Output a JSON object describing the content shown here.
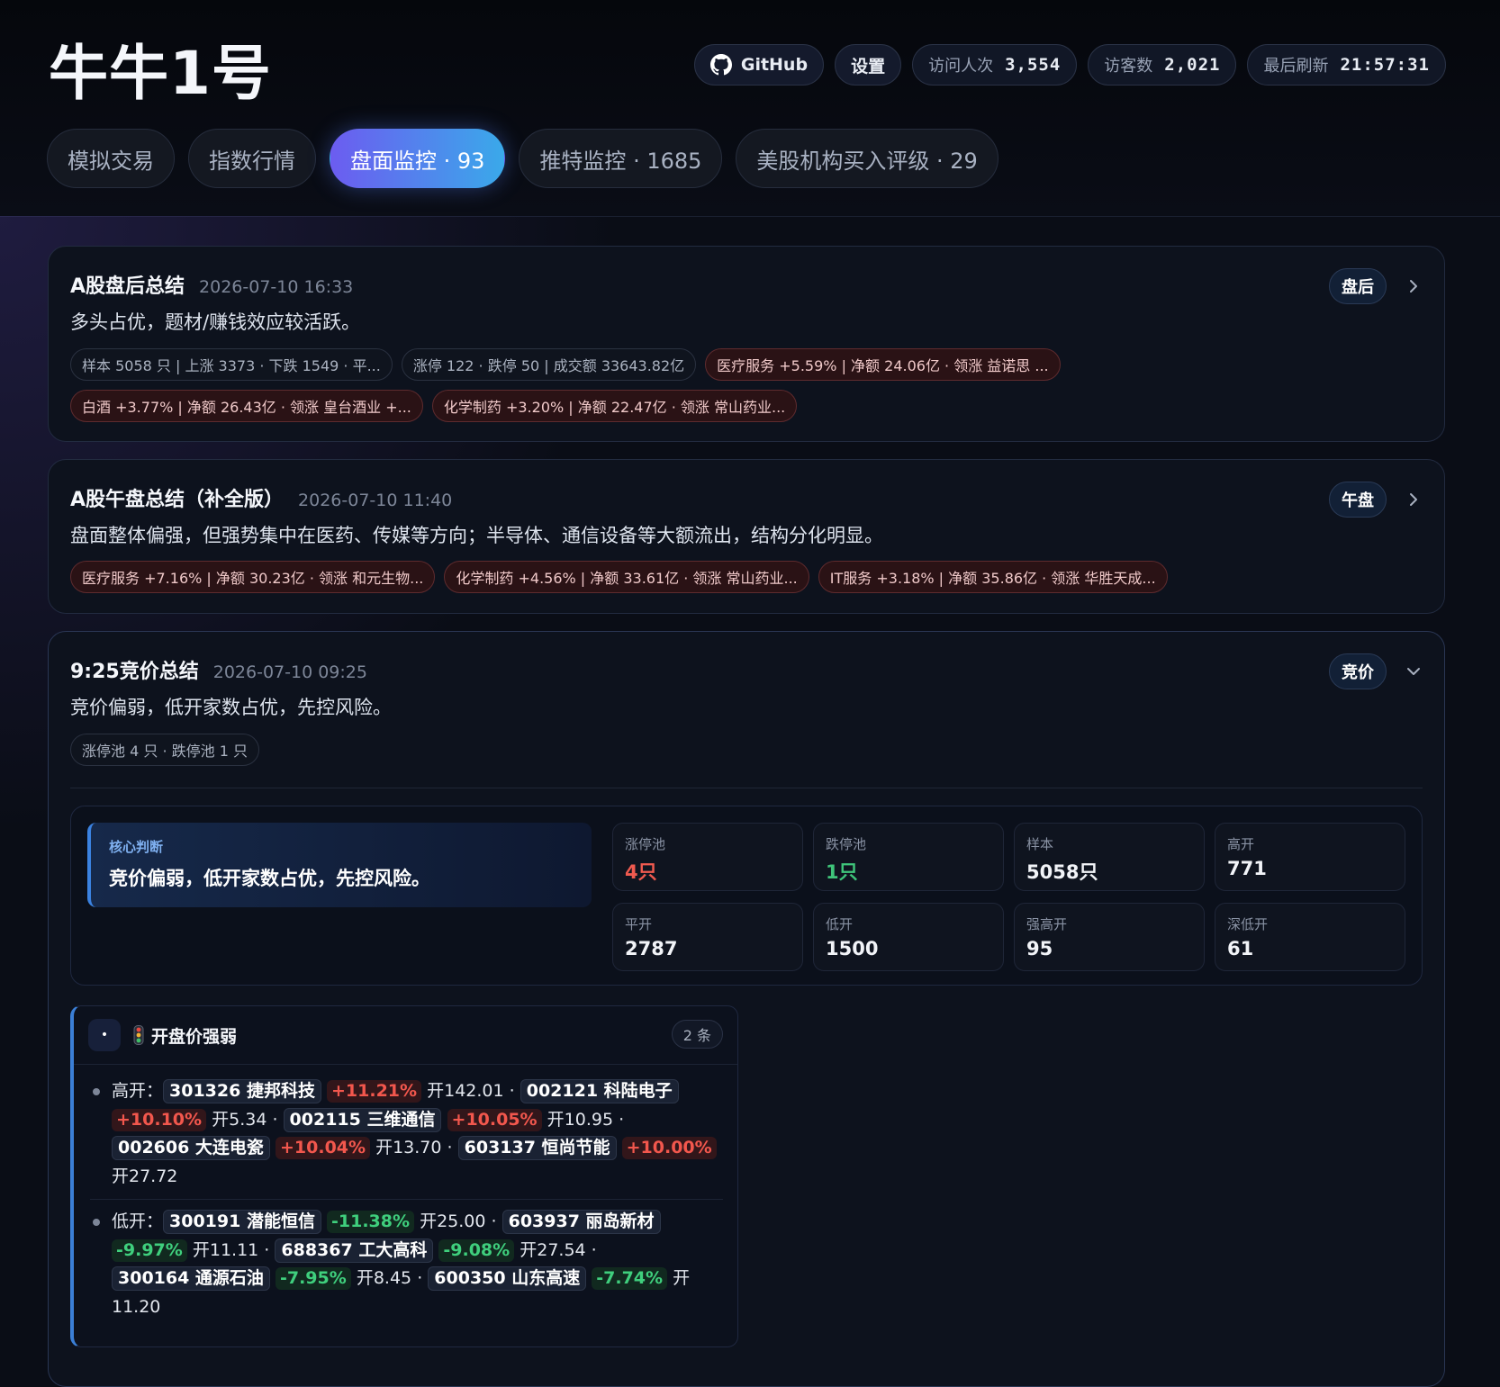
{
  "app": {
    "title": "牛牛1号"
  },
  "header": {
    "github_label": "GitHub",
    "settings_label": "设置",
    "visits_label": "访问人次",
    "visits_value": "3,554",
    "visitors_label": "访客数",
    "visitors_value": "2,021",
    "refresh_label": "最后刷新",
    "refresh_value": "21:57:31"
  },
  "tabs": [
    {
      "label": "模拟交易"
    },
    {
      "label": "指数行情"
    },
    {
      "label": "盘面监控 · 93",
      "active": true
    },
    {
      "label": "推特监控 · 1685"
    },
    {
      "label": "美股机构买入评级 · 29"
    }
  ],
  "cards": [
    {
      "title": "A股盘后总结",
      "time": "2026-07-10 16:33",
      "summary": "多头占优，题材/赚钱效应较活跃。",
      "badge": "盘后",
      "tags": [
        "样本 5058 只 | 上涨 3373 · 下跌 1549 · 平...",
        "涨停 122 · 跌停 50 | 成交额 33643.82亿",
        "医疗服务 +5.59% | 净额 24.06亿 · 领涨 益诺思 ...",
        "白酒 +3.77% | 净额 26.43亿 · 领涨 皇台酒业 +...",
        "化学制药 +3.20% | 净额 22.47亿 · 领涨 常山药业..."
      ]
    },
    {
      "title": "A股午盘总结（补全版）",
      "time": "2026-07-10 11:40",
      "summary": "盘面整体偏强，但强势集中在医药、传媒等方向；半导体、通信设备等大额流出，结构分化明显。",
      "badge": "午盘",
      "tags": [
        "医疗服务 +7.16% | 净额 30.23亿 · 领涨 和元生物...",
        "化学制药 +4.56% | 净额 33.61亿 · 领涨 常山药业...",
        "IT服务 +3.18% | 净额 35.86亿 · 领涨 华胜天成..."
      ]
    },
    {
      "title": "9:25竞价总结",
      "time": "2026-07-10 09:25",
      "summary": "竞价偏弱，低开家数占优，先控风险。",
      "badge": "竞价",
      "tags": [
        "涨停池 4 只 · 跌停池 1 只"
      ],
      "core_label": "核心判断",
      "core_text": "竞价偏弱，低开家数占优，先控风险。",
      "stats": [
        {
          "label": "涨停池",
          "value": "4只"
        },
        {
          "label": "跌停池",
          "value": "1只"
        },
        {
          "label": "样本",
          "value": "5058只"
        },
        {
          "label": "高开",
          "value": "771"
        },
        {
          "label": "平开",
          "value": "2787"
        },
        {
          "label": "低开",
          "value": "1500"
        },
        {
          "label": "强高开",
          "value": "95"
        },
        {
          "label": "深低开",
          "value": "61"
        }
      ],
      "section": {
        "title": "开盘价强弱",
        "count": "2 条",
        "dot": "•",
        "rows": [
          {
            "label": "高开：",
            "items": [
              {
                "stock": "301326 捷邦科技",
                "change": "+11.21%",
                "open": "开142.01"
              },
              {
                "stock": "002121 科陆电子",
                "change": "+10.10%",
                "open": "开5.34"
              },
              {
                "stock": "002115 三维通信",
                "change": "+10.05%",
                "open": "开10.95"
              },
              {
                "stock": "002606 大连电瓷",
                "change": "+10.04%",
                "open": "开13.70"
              },
              {
                "stock": "603137 恒尚节能",
                "change": "+10.00%",
                "open": "开27.72"
              }
            ]
          },
          {
            "label": "低开：",
            "items": [
              {
                "stock": "300191 潜能恒信",
                "change": "-11.38%",
                "open": "开25.00"
              },
              {
                "stock": "603937 丽岛新材",
                "change": "-9.97%",
                "open": "开11.11"
              },
              {
                "stock": "688367 工大高科",
                "change": "-9.08%",
                "open": "开27.54"
              },
              {
                "stock": "300164 通源石油",
                "change": "-7.95%",
                "open": "开8.45"
              },
              {
                "stock": "600350 山东高速",
                "change": "-7.74%",
                "open": "开11.20"
              }
            ]
          }
        ]
      }
    }
  ],
  "colors": {
    "accent": "#5b7cf0",
    "up": "#f05a4f",
    "down": "#3fc57a",
    "background": "#0a0d16"
  },
  "icons": {
    "github": "github-icon",
    "chevron_right": "chevron-right-icon",
    "chevron_down": "chevron-down-icon",
    "traffic_light": "traffic-light-icon"
  }
}
